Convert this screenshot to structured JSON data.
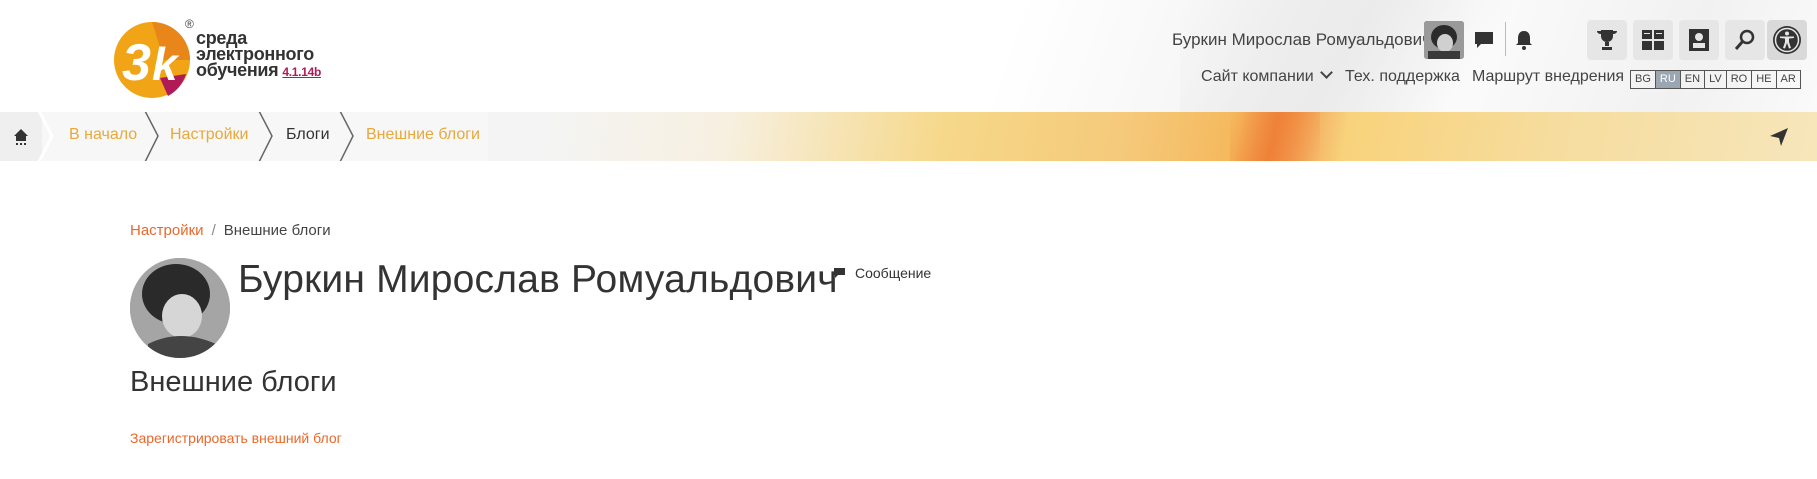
{
  "logo": {
    "mark": "3k",
    "reg": "®",
    "line1": "среда",
    "line2": "электронного",
    "line3": "обучения",
    "version": "4.1.14b"
  },
  "header": {
    "user_name": "Буркин Мирослав Ромуальдович",
    "icons": [
      "messages-icon",
      "bell-icon"
    ],
    "tools": [
      "trophy-icon",
      "dashboard-icon",
      "profile-card-icon",
      "search-icon",
      "accessibility-icon"
    ],
    "nav": {
      "company_site": "Сайт компании",
      "support": "Тех. поддержка",
      "route": "Маршрут внедрения"
    },
    "languages": [
      "BG",
      "RU",
      "EN",
      "LV",
      "RO",
      "HE",
      "AR"
    ],
    "active_language": "RU"
  },
  "crumbs": {
    "home_icon": "home-icon",
    "items": [
      {
        "label": "В начало"
      },
      {
        "label": "Настройки"
      },
      {
        "label": "Блоги"
      },
      {
        "label": "Внешние блоги"
      }
    ],
    "send_icon": "paper-plane-icon"
  },
  "page": {
    "breadcrumb": {
      "parent": "Настройки",
      "separator": "/",
      "current": "Внешние блоги"
    },
    "profile_name": "Буркин Мирослав Ромуальдович",
    "message_label": "Сообщение",
    "section_title": "Внешние блоги",
    "register_link": "Зарегистрировать внешний блог"
  },
  "colors": {
    "accent_orange": "#e8692c",
    "crumb_link": "#e9a83a",
    "logo_orange": "#f0a416",
    "logo_magenta": "#b01a57"
  }
}
